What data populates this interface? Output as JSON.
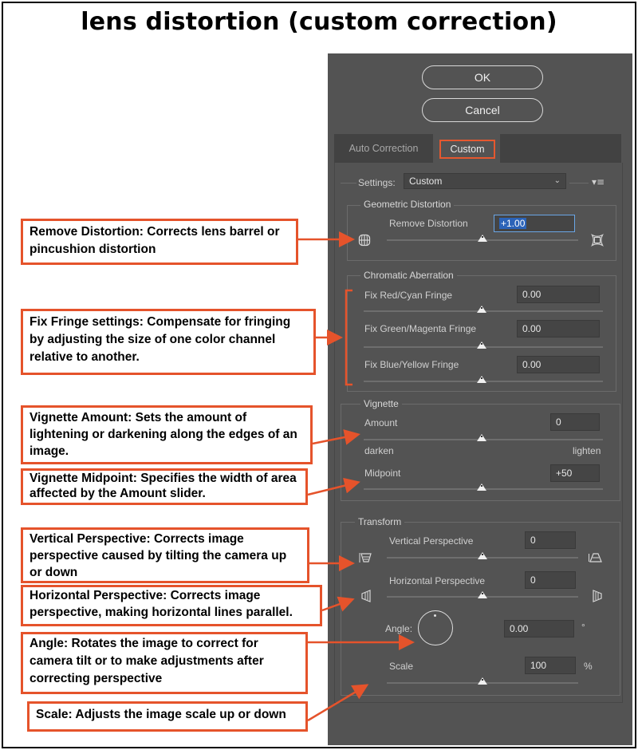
{
  "title": "lens distortion (custom correction)",
  "buttons": {
    "ok": "OK",
    "cancel": "Cancel"
  },
  "tabs": {
    "auto": "Auto Correction",
    "custom": "Custom"
  },
  "settings": {
    "label": "Settings:",
    "value": "Custom",
    "menu_icon": "flyout-menu-icon"
  },
  "geometric": {
    "title": "Geometric Distortion",
    "remove_label": "Remove Distortion",
    "remove_value": "+1.00",
    "remove_fraction": 0.5
  },
  "chromatic": {
    "title": "Chromatic Aberration",
    "red_label": "Fix Red/Cyan Fringe",
    "red_value": "0.00",
    "green_label": "Fix Green/Magenta Fringe",
    "green_value": "0.00",
    "blue_label": "Fix Blue/Yellow Fringe",
    "blue_value": "0.00"
  },
  "vignette": {
    "title": "Vignette",
    "amount_label": "Amount",
    "amount_value": "0",
    "darken": "darken",
    "lighten": "lighten",
    "midpoint_label": "Midpoint",
    "midpoint_value": "+50"
  },
  "transform": {
    "title": "Transform",
    "vertical_label": "Vertical Perspective",
    "vertical_value": "0",
    "horizontal_label": "Horizontal Perspective",
    "horizontal_value": "0",
    "angle_label": "Angle:",
    "angle_value": "0.00",
    "angle_unit": "°",
    "scale_label": "Scale",
    "scale_value": "100",
    "scale_unit": "%"
  },
  "callouts": {
    "remove": "Remove Distortion: Corrects lens barrel or pincushion distortion",
    "fringe": "Fix Fringe settings: Compensate for fringing by adjusting the size of one color channel relative to another.",
    "vig_amount": "Vignette Amount: Sets the amount of lightening or darkening along the edges of an image.",
    "vig_midpoint": "Vignette Midpoint: Specifies the width of area affected by the Amount slider.",
    "vertical": "Vertical Perspective: Corrects image perspective caused by tilting the camera up or down",
    "horizontal": "Horizontal Perspective: Corrects image perspective, making horizontal lines parallel.",
    "angle": "Angle: Rotates the image to correct for camera tilt or to make adjustments after correcting perspective",
    "scale": "Scale: Adjusts the image scale up or down"
  },
  "colors": {
    "panel": "#535353",
    "accent": "#e5532b",
    "selection": "#2b63b8"
  }
}
